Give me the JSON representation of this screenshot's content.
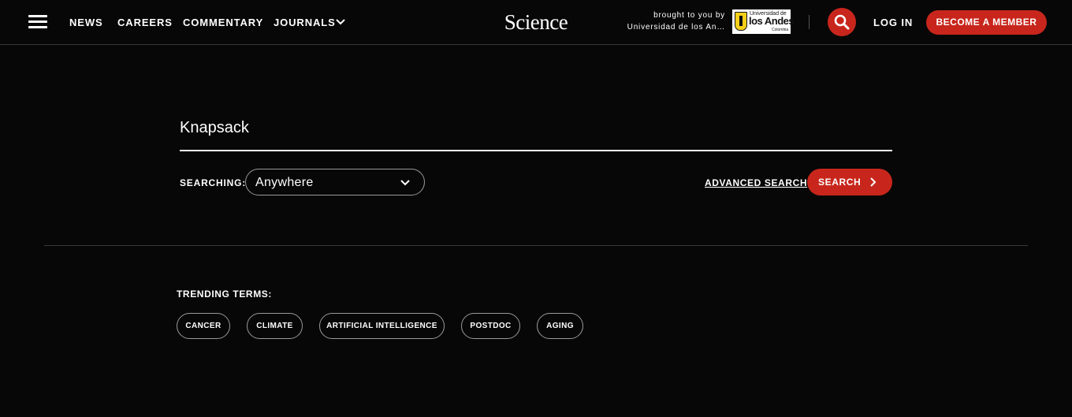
{
  "header": {
    "nav": [
      "NEWS",
      "CAREERS",
      "COMMENTARY",
      "JOURNALS"
    ],
    "logo": "Science",
    "sponsor": {
      "line1": "brought to you by",
      "line2": "Universidad de los An…",
      "logo_text": {
        "top": "Universidad de",
        "main": "los Andes",
        "sub": "Colombia"
      }
    },
    "search_icon": "search-icon",
    "login": "LOG IN",
    "member_button": "BECOME A MEMBER"
  },
  "search": {
    "query": "Knapsack",
    "searching_label": "SEARCHING:",
    "scope": "Anywhere",
    "advanced": "ADVANCED SEARCH",
    "button": "SEARCH"
  },
  "trending": {
    "label": "TRENDING TERMS:",
    "terms": [
      "CANCER",
      "CLIMATE",
      "ARTIFICIAL INTELLIGENCE",
      "POSTDOC",
      "AGING"
    ]
  },
  "colors": {
    "accent": "#c8261c",
    "background": "#070707",
    "text": "#ffffff"
  }
}
